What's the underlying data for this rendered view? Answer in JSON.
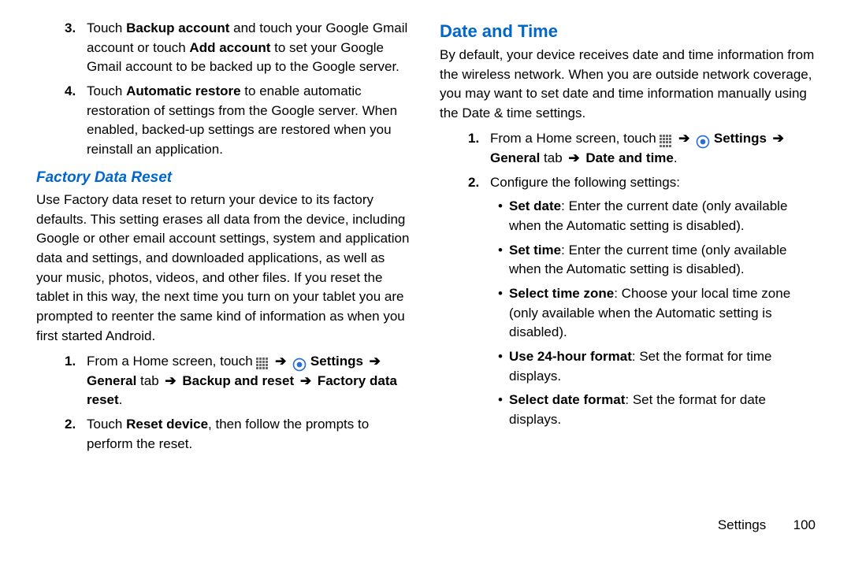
{
  "left": {
    "step3": {
      "num": "3.",
      "t1": "Touch ",
      "b1": "Backup account",
      "t2": " and touch your Google Gmail account or touch ",
      "b2": "Add account",
      "t3": " to set your Google Gmail account to be backed up to the Google server."
    },
    "step4": {
      "num": "4.",
      "t1": "Touch ",
      "b1": "Automatic restore",
      "t2": " to enable automatic restoration of settings from the Google server. When enabled, backed-up settings are restored when you reinstall an application."
    },
    "h2": "Factory Data Reset",
    "para": "Use Factory data reset to return your device to its factory defaults. This setting erases all data from the device, including Google or other email account settings, system and application data and settings, and downloaded applications, as well as your music, photos, videos, and other files. If you reset the tablet in this way, the next time you turn on your tablet you are prompted to reenter the same kind of information as when you first started Android.",
    "fstep1": {
      "num": "1.",
      "t1": "From a Home screen, touch ",
      "settings": "Settings",
      "general": "General",
      "tab": " tab ",
      "bur": "Backup and reset",
      "fdr": "Factory data reset",
      "period": "."
    },
    "fstep2": {
      "num": "2.",
      "t1": "Touch ",
      "b1": "Reset device",
      "t2": ", then follow the prompts to perform the reset."
    }
  },
  "right": {
    "h1": "Date and Time",
    "intro": "By default, your device receives date and time information from the wireless network. When you are outside network coverage, you may want to set date and time information manually using the Date & time settings.",
    "rstep1": {
      "num": "1.",
      "t1": "From a Home screen, touch ",
      "settings": "Settings",
      "general": "General",
      "tab": " tab ",
      "dat": "Date and time",
      "period": "."
    },
    "rstep2": {
      "num": "2.",
      "t1": "Configure the following settings:"
    },
    "bul1": {
      "b": "Set date",
      "t": ": Enter the current date (only available when the Automatic setting is disabled)."
    },
    "bul2": {
      "b": "Set time",
      "t": ": Enter the current time (only available when the Automatic setting is disabled)."
    },
    "bul3": {
      "b": "Select time zone",
      "t": ": Choose your local time zone (only available when the Automatic setting is disabled)."
    },
    "bul4": {
      "b": "Use 24-hour format",
      "t": ": Set the format for time displays."
    },
    "bul5": {
      "b": "Select date format",
      "t": ": Set the format for date displays."
    }
  },
  "footer": {
    "section": "Settings",
    "page": "100"
  },
  "glyphs": {
    "arrow": "➔",
    "bullet": "•"
  }
}
